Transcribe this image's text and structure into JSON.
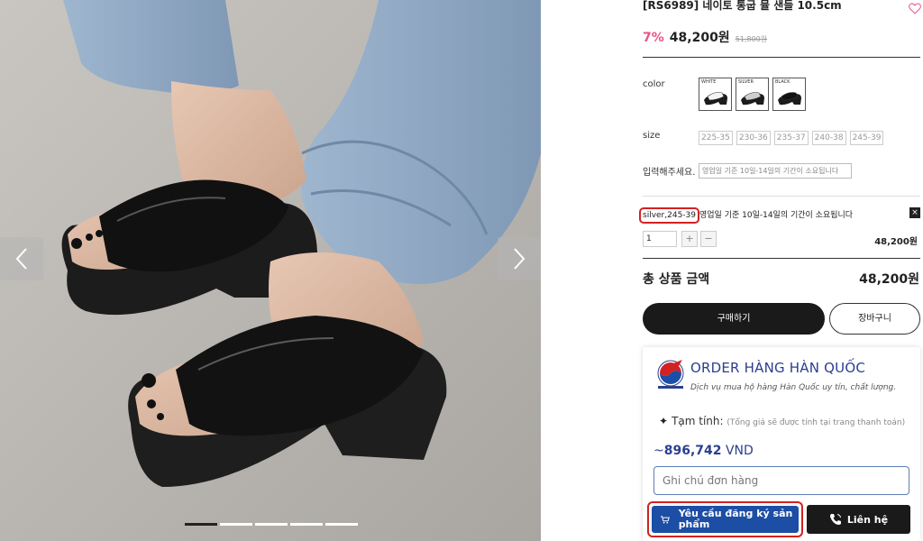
{
  "product": {
    "title": "[RS6989] 네이토 통굽 뮬 샌들 10.5cm",
    "discount": "7%",
    "price": "48,200원",
    "original_price": "51,800원"
  },
  "options": {
    "color_label": "color",
    "colors": [
      "WHITE",
      "SILVER",
      "BLACK"
    ],
    "size_label": "size",
    "sizes": [
      "225-35",
      "230-36",
      "235-37",
      "240-38",
      "245-39"
    ],
    "memo_label": "입력해주세요.",
    "memo_value": "영업일 기준 10일-14일의 기간이 소요됩니다"
  },
  "selection": {
    "option": "silver,245-39",
    "note": "영업일 기준 10일-14일의 기간이 소요됩니다",
    "delete": "×",
    "qty": "1",
    "plus": "+",
    "minus": "−",
    "line_price": "48,200원"
  },
  "total": {
    "label": "총 상품 금액",
    "value": "48,200원"
  },
  "buttons": {
    "buy": "구매하기",
    "cart": "장바구니"
  },
  "order_widget": {
    "title": "ORDER HÀNG HÀN QUỐC",
    "subtitle": "Dịch vụ mua hộ hàng Hàn Quốc uy tín, chất lượng.",
    "estimate_label": "Tạm tính:",
    "estimate_note": "(Tổng giá sẽ được tính tại trang thanh toán)",
    "estimate_prefix": "~",
    "estimate_value": "896,742",
    "estimate_currency": "VND",
    "note_placeholder": "Ghi chú đơn hàng",
    "request_button": "Yêu cầu đăng ký sản phẩm",
    "contact_button": "Liên hệ"
  },
  "gallery": {
    "slide_count": 5,
    "active_slide": 1
  },
  "colors": {
    "discount": "#e8548a",
    "brand_blue": "#2b3f8f",
    "request_button": "#1d4ea5",
    "highlight_border": "#d32121",
    "dark_button": "#1a1a1a"
  },
  "icons": [
    "chevron-left-icon",
    "chevron-right-icon",
    "heart-icon",
    "cart-icon",
    "phone-icon",
    "sparkle-icon",
    "logo-icon"
  ]
}
